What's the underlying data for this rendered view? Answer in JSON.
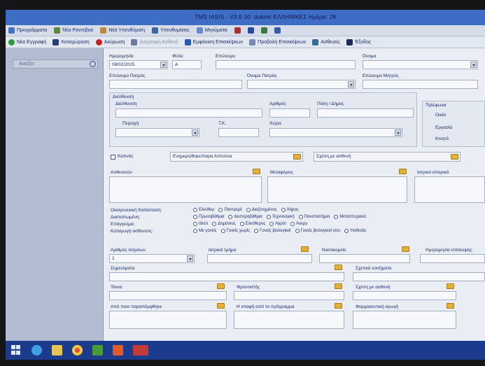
{
  "window": {
    "title": "TMS IASIS - V3.0   30: dokimi ΕΛΛΗΝΙΚΕΣ   Ημέρα: 28"
  },
  "menubar": [
    {
      "label": "Προγράμματα",
      "icon": "app-icon"
    },
    {
      "label": "Νέα Ραντεβού",
      "icon": "calendar-icon"
    },
    {
      "label": "Νέα Υπενθύμιση",
      "icon": "reminder-icon"
    },
    {
      "label": "Υπενθυμίσεις",
      "icon": "list-icon"
    },
    {
      "label": "Μηνύματα",
      "icon": "message-icon"
    }
  ],
  "toolbar": [
    {
      "label": "Νέα Εγγραφή",
      "icon": "add-icon",
      "enabled": true
    },
    {
      "label": "Καταχώρηση",
      "icon": "save-icon",
      "enabled": true
    },
    {
      "label": "Ακύρωση",
      "icon": "cancel-icon",
      "enabled": true
    },
    {
      "label": "Διαγραφή Ασθενή",
      "icon": "delete-icon",
      "enabled": false
    },
    {
      "label": "Εμφάνιση Επισκέψεων",
      "icon": "visits-icon",
      "enabled": true
    },
    {
      "label": "Προβολή Επισκέψεων",
      "icon": "view-icon",
      "enabled": true
    },
    {
      "label": "Ασθενείς",
      "icon": "patients-icon",
      "enabled": true
    },
    {
      "label": "Έξοδος",
      "icon": "exit-icon",
      "enabled": true
    }
  ],
  "sidebar": {
    "search_placeholder": "Αναζήτ"
  },
  "form": {
    "registration_date_label": "Ημερομηνία",
    "registration_date_value": "08/02/2015",
    "gender_label": "Φύλο",
    "gender_value": "Α",
    "surname_label": "Επώνυμο",
    "name_label": "Όνομα",
    "father_surname_label": "Επώνυμο Πατρός",
    "father_name_label": "Όνομα Πατρός",
    "mother_surname_label": "Επώνυμο Μητρός",
    "address_group_label": "Διεύθυνση",
    "street_label": "Διεύθυνση",
    "number_label": "Αριθμός",
    "city_label": "Πόλη / Δήμος",
    "area_label": "Περιοχή",
    "zip_label": "Τ.Κ.",
    "country_label": "Χώρα",
    "phones_group_label": "Τηλέφωνα",
    "phone_home_label": "Οικία",
    "phone_work_label": "Εργασία",
    "phone_mobile_label": "Κινητό",
    "smoker_label": "Καπνός",
    "referral_label": "Ενημερώθηκε/παρα Απτούνα",
    "relation_label": "Σχέση με ασθενή",
    "illness_label": "Ασθενειών",
    "transfer_label": "Μεταφέρεις",
    "notes_label": "Ιατρικό ιστορικό",
    "marital_label": "Οικογενειακή Κατάσταση:",
    "education_label": "Διαπιστωμένη:",
    "profession_label": "Επάγγελμα:",
    "insurance_label": "Καταγωγή ασθενούς:",
    "marital_options": [
      "Ελεύθερ",
      "Παντρεμέ",
      "Διαζευγμένος",
      "Χήρος"
    ],
    "education_options": [
      "Πρωτοβάθμια",
      "Δευτεροβάθμια",
      "Τεχνολογική",
      "Πανεπιστήμιο",
      "Μεταπτυχιακά"
    ],
    "profession_options": [
      "Ιδιώτ",
      "Δημόσιος",
      "Ελεύθερος",
      "Αγρότ",
      "Άνεργ"
    ],
    "insurance_options": [
      "Με γονείς",
      "Γονείς χωρίς",
      "Γονείς βιολογικοί",
      "Γονείς βιολογικοί νέοι",
      "Υιοθεσία"
    ],
    "visit_number_label": "Αριθμός Ιατρείων",
    "visit_number_value": "1",
    "doctor_label": "Ιατρικά τμήμα",
    "nurse_label": "Νοσοκομείο",
    "appointment_label": "Ημερομηνία επίσκεψης",
    "comments_label": "Σημειώματα",
    "history_label": "Σχετικά νοσήματα",
    "children_label": "Τέκνα",
    "assistant_label": "Φροντιστής",
    "relation2_label": "Σχέση με ασθενή",
    "contact_label": "Από ποιο παραπέμφθηκε",
    "info_label": "Η επαφή από το πρόγραμμα",
    "medication_label": "Φαρμακευτική αγωγή"
  },
  "taskbar": [
    {
      "icon": "windows-icon"
    },
    {
      "icon": "internet-explorer-icon"
    },
    {
      "icon": "file-explorer-icon"
    },
    {
      "icon": "chrome-icon"
    },
    {
      "icon": "app-green-icon"
    },
    {
      "icon": "office-icon"
    },
    {
      "icon": "tms-app-icon"
    }
  ],
  "colors": {
    "titlebar": "#3e6dc6",
    "sidebar": "#b3bcd0",
    "form_bg": "#eaeef4",
    "taskbar": "#1b3b8c",
    "folder": "#e2b13a"
  }
}
